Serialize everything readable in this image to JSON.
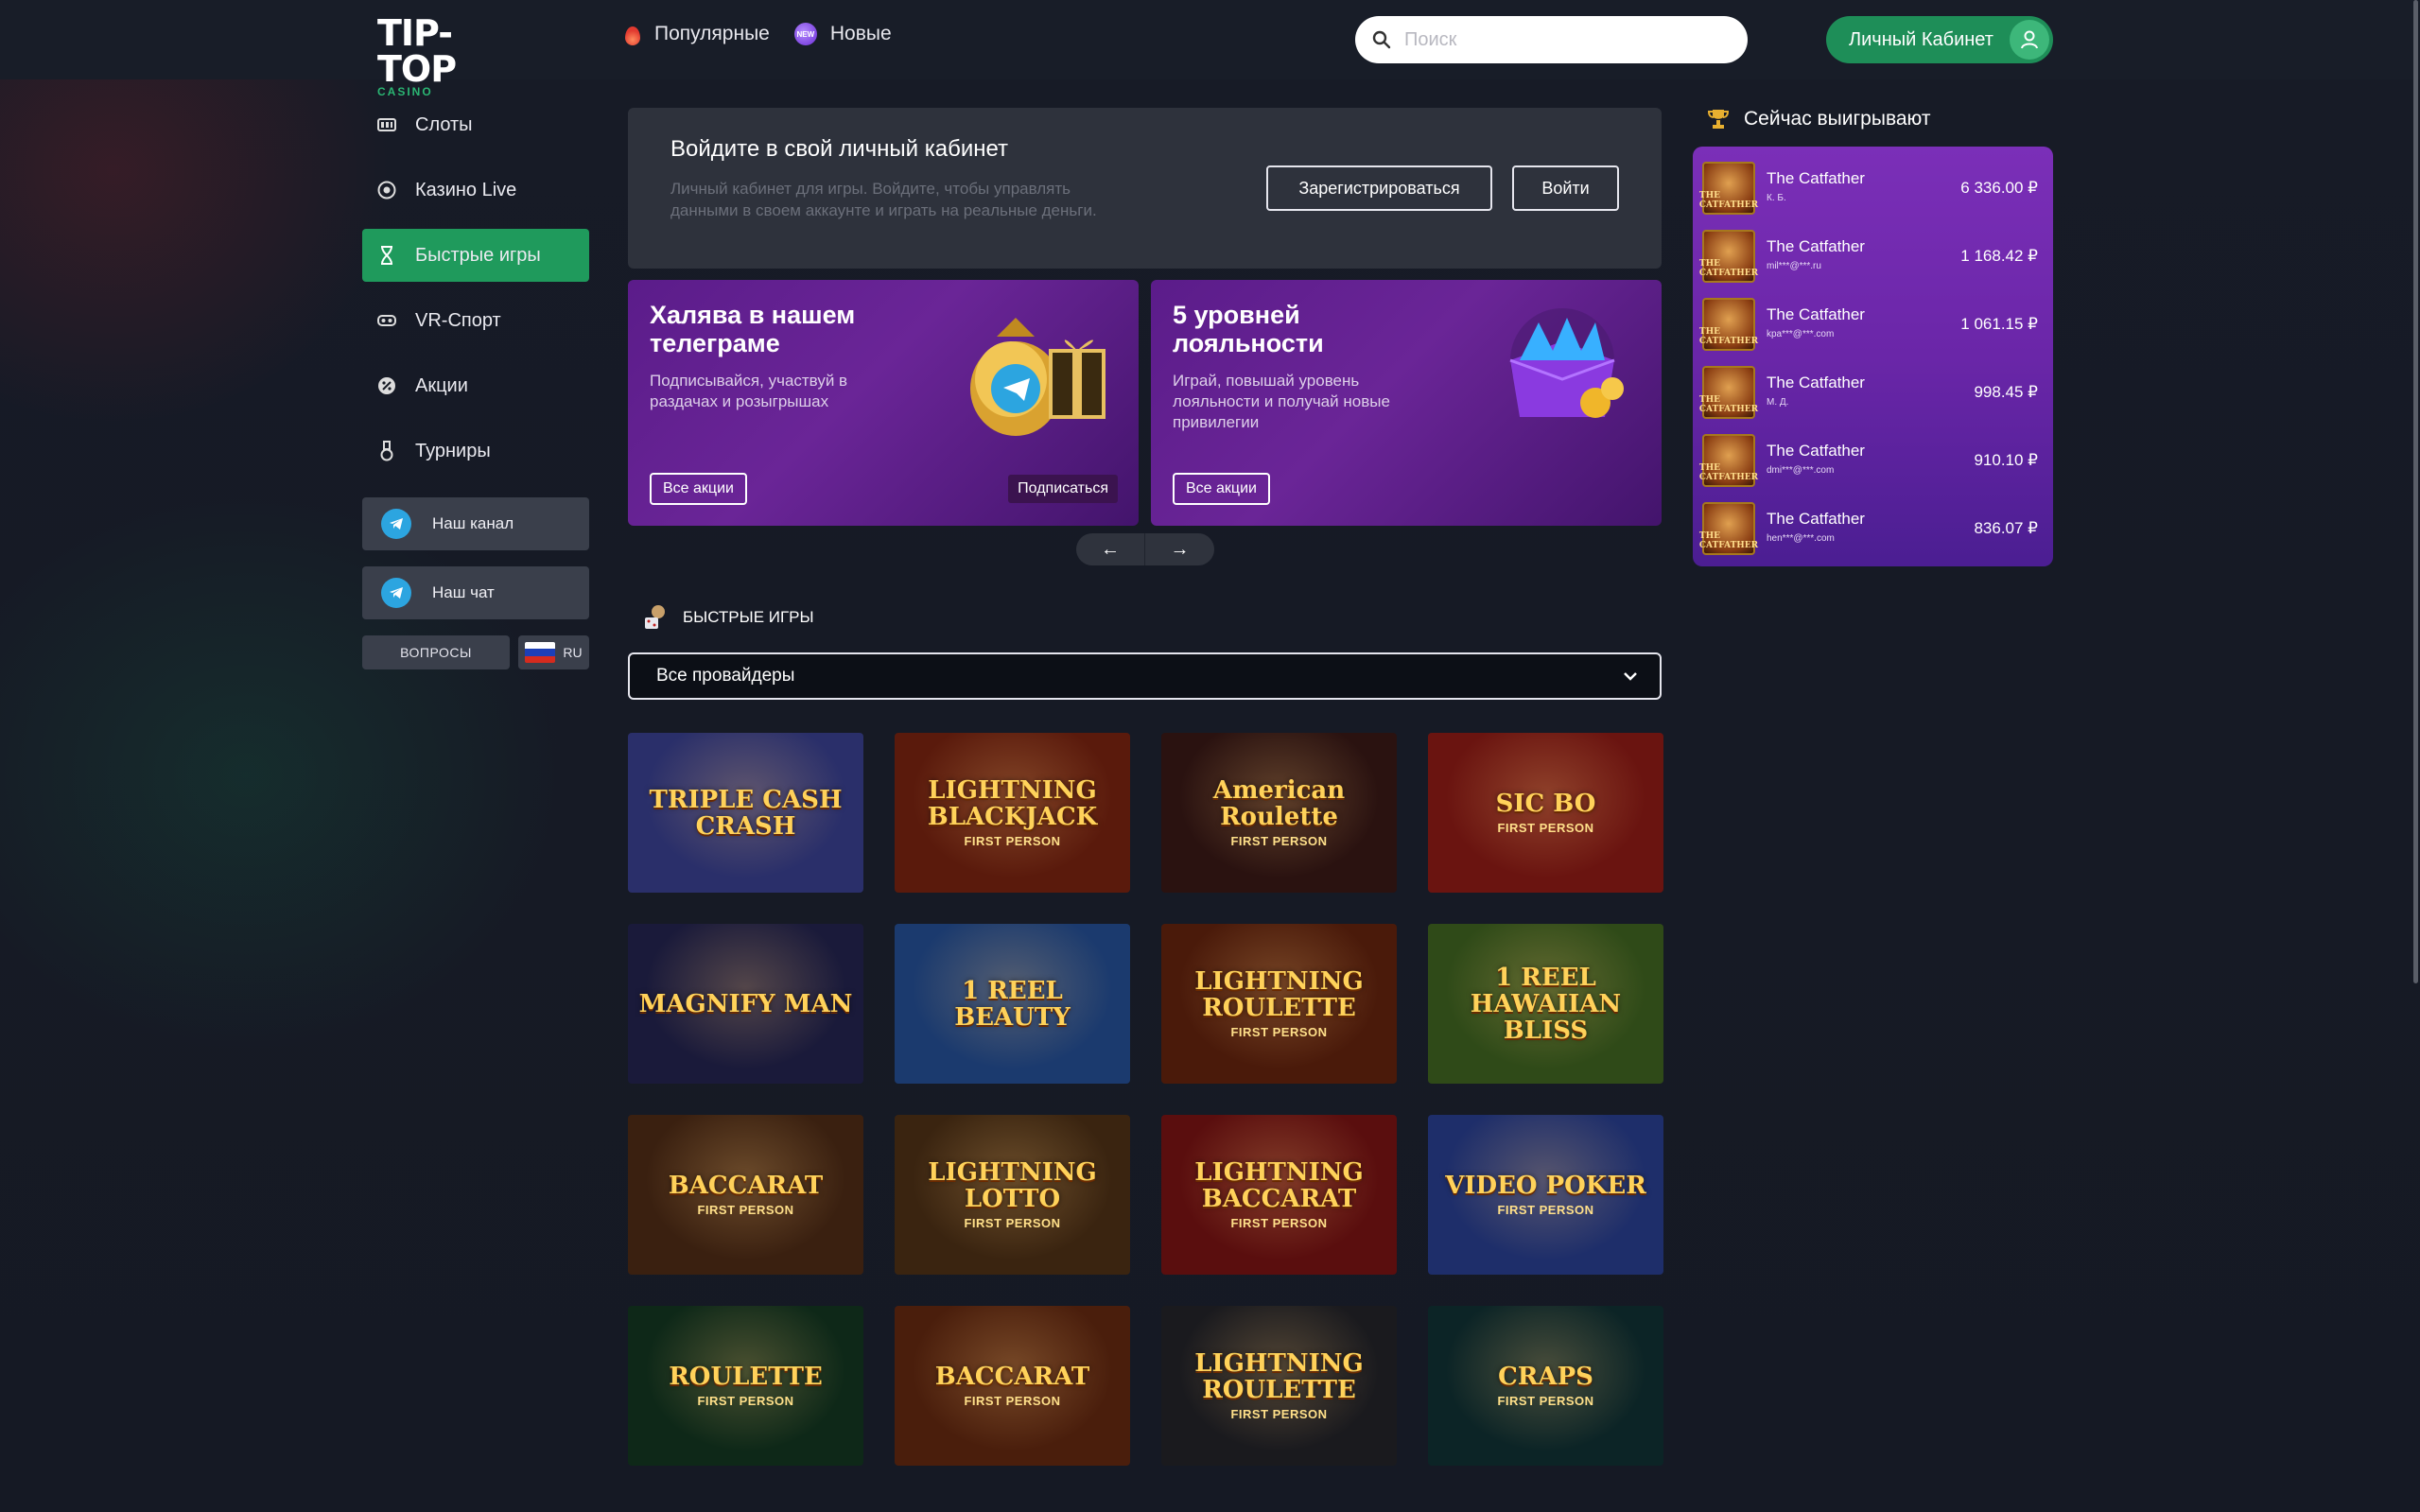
{
  "brand": {
    "logo_main": "TIP-TOP",
    "logo_sub": "CASINO"
  },
  "header": {
    "nav": [
      {
        "label": "Популярные",
        "icon": "fire-icon"
      },
      {
        "label": "Новые",
        "icon": "new-badge-icon"
      }
    ],
    "search_placeholder": "Поиск",
    "cabinet_label": "Личный Кабинет"
  },
  "sidebar": {
    "items": [
      {
        "label": "Слоты",
        "icon": "slot-machine-icon"
      },
      {
        "label": "Казино Live",
        "icon": "live-casino-icon"
      },
      {
        "label": "Быстрые игры",
        "icon": "hourglass-icon",
        "active": true
      },
      {
        "label": "VR-Спорт",
        "icon": "vr-headset-icon"
      },
      {
        "label": "Акции",
        "icon": "percent-badge-icon"
      },
      {
        "label": "Турниры",
        "icon": "medal-icon"
      }
    ],
    "channel_label": "Наш канал",
    "chat_label": "Наш чат",
    "faq_label": "ВОПРОСЫ",
    "lang_label": "RU"
  },
  "login_card": {
    "title": "Войдите в свой личный кабинет",
    "desc": "Личный кабинет для игры. Войдите, чтобы управлять данными в своем аккаунте и играть на реальные деньги.",
    "register_label": "Зарегистрироваться",
    "login_label": "Войти"
  },
  "promos": [
    {
      "title": "Халява в нашем телеграме",
      "desc": "Подписывайся, участвуй в раздачах и розыгрышах",
      "button": "Все акции",
      "secondary": "Подписаться"
    },
    {
      "title": "5 уровней лояльности",
      "desc": "Играй, повышай уровень лояльности и получай новые привилегии",
      "button": "Все акции"
    }
  ],
  "carousel": {
    "prev": "←",
    "next": "→"
  },
  "section": {
    "title": "БЫСТРЫЕ ИГРЫ",
    "provider": "Все провайдеры"
  },
  "games": [
    {
      "name": "TRIPLE CASH CRASH",
      "sub": "",
      "bg": "#2a2f6a"
    },
    {
      "name": "LIGHTNING BLACKJACK",
      "sub": "FIRST PERSON",
      "bg": "#5a1a0c"
    },
    {
      "name": "American Roulette",
      "sub": "FIRST PERSON",
      "bg": "#2a1210"
    },
    {
      "name": "SIC BO",
      "sub": "FIRST PERSON",
      "bg": "#6a1410"
    },
    {
      "name": "MAGNIFY MAN",
      "sub": "",
      "bg": "#1a1a3a"
    },
    {
      "name": "1 REEL BEAUTY",
      "sub": "",
      "bg": "#1b3a6e"
    },
    {
      "name": "LIGHTNING ROULETTE",
      "sub": "FIRST PERSON",
      "bg": "#4a1a0a"
    },
    {
      "name": "1 REEL HAWAIIAN BLISS",
      "sub": "",
      "bg": "#2f4a18"
    },
    {
      "name": "BACCARAT",
      "sub": "FIRST PERSON",
      "bg": "#3a2010"
    },
    {
      "name": "LIGHTNING LOTTO",
      "sub": "FIRST PERSON",
      "bg": "#3a2410"
    },
    {
      "name": "LIGHTNING BACCARAT",
      "sub": "FIRST PERSON",
      "bg": "#5a0e0e"
    },
    {
      "name": "VIDEO POKER",
      "sub": "FIRST PERSON",
      "bg": "#1e2e6a"
    },
    {
      "name": "ROULETTE",
      "sub": "FIRST PERSON",
      "bg": "#0e2818"
    },
    {
      "name": "BACCARAT",
      "sub": "FIRST PERSON",
      "bg": "#4a1e0c"
    },
    {
      "name": "LIGHTNING ROULETTE",
      "sub": "FIRST PERSON",
      "bg": "#1a1a1e"
    },
    {
      "name": "CRAPS",
      "sub": "FIRST PERSON",
      "bg": "#0c2426"
    }
  ],
  "winners": {
    "title": "Сейчас выигрывают",
    "rows": [
      {
        "game": "The Catfather",
        "user": "К. Б.",
        "amount": "6 336.00  ₽"
      },
      {
        "game": "The Catfather",
        "user": "mil***@***.ru",
        "amount": "1 168.42  ₽"
      },
      {
        "game": "The Catfather",
        "user": "kpa***@***.com",
        "amount": "1 061.15  ₽"
      },
      {
        "game": "The Catfather",
        "user": "М. Д.",
        "amount": "998.45  ₽"
      },
      {
        "game": "The Catfather",
        "user": "dmi***@***.com",
        "amount": "910.10  ₽"
      },
      {
        "game": "The Catfather",
        "user": "hen***@***.com",
        "amount": "836.07  ₽"
      }
    ]
  },
  "colors": {
    "accent": "#1f9a5c",
    "promo": "#5b1c8a",
    "bg": "#151a24"
  }
}
